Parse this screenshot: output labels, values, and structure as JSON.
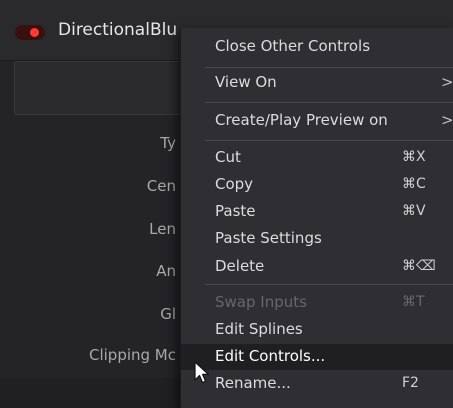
{
  "node": {
    "title": "DirectionalBlu",
    "params": [
      "Ty",
      "Cen",
      "Len",
      "An",
      "Gl",
      "Clipping Mc"
    ]
  },
  "menu": {
    "items": [
      {
        "label": "Close Other Controls",
        "shortcut": "",
        "arrow": "",
        "disabled": false
      },
      {
        "label": "View On",
        "shortcut": "",
        "arrow": ">",
        "disabled": false
      },
      {
        "label": "Create/Play Preview on",
        "shortcut": "",
        "arrow": ">",
        "disabled": false
      },
      {
        "label": "Cut",
        "shortcut": "⌘X",
        "arrow": "",
        "disabled": false
      },
      {
        "label": "Copy",
        "shortcut": "⌘C",
        "arrow": "",
        "disabled": false
      },
      {
        "label": "Paste",
        "shortcut": "⌘V",
        "arrow": "",
        "disabled": false
      },
      {
        "label": "Paste Settings",
        "shortcut": "",
        "arrow": "",
        "disabled": false
      },
      {
        "label": "Delete",
        "shortcut": "⌘⌫",
        "arrow": "",
        "disabled": false
      },
      {
        "label": "Swap Inputs",
        "shortcut": "⌘T",
        "arrow": "",
        "disabled": true
      },
      {
        "label": "Edit Splines",
        "shortcut": "",
        "arrow": "",
        "disabled": false
      },
      {
        "label": "Edit Controls...",
        "shortcut": "",
        "arrow": "",
        "disabled": false,
        "highlighted": true
      },
      {
        "label": "Rename...",
        "shortcut": "F2",
        "arrow": "",
        "disabled": false
      }
    ]
  },
  "colors": {
    "toggle_dot": "#ff3b30",
    "menu_bg": "#2f2f33",
    "highlight_bg": "#1f1f22"
  },
  "icons": {
    "cursor": "mouse-pointer-icon",
    "submenu": "chevron-right-icon",
    "toggle": "node-toggle-icon"
  }
}
